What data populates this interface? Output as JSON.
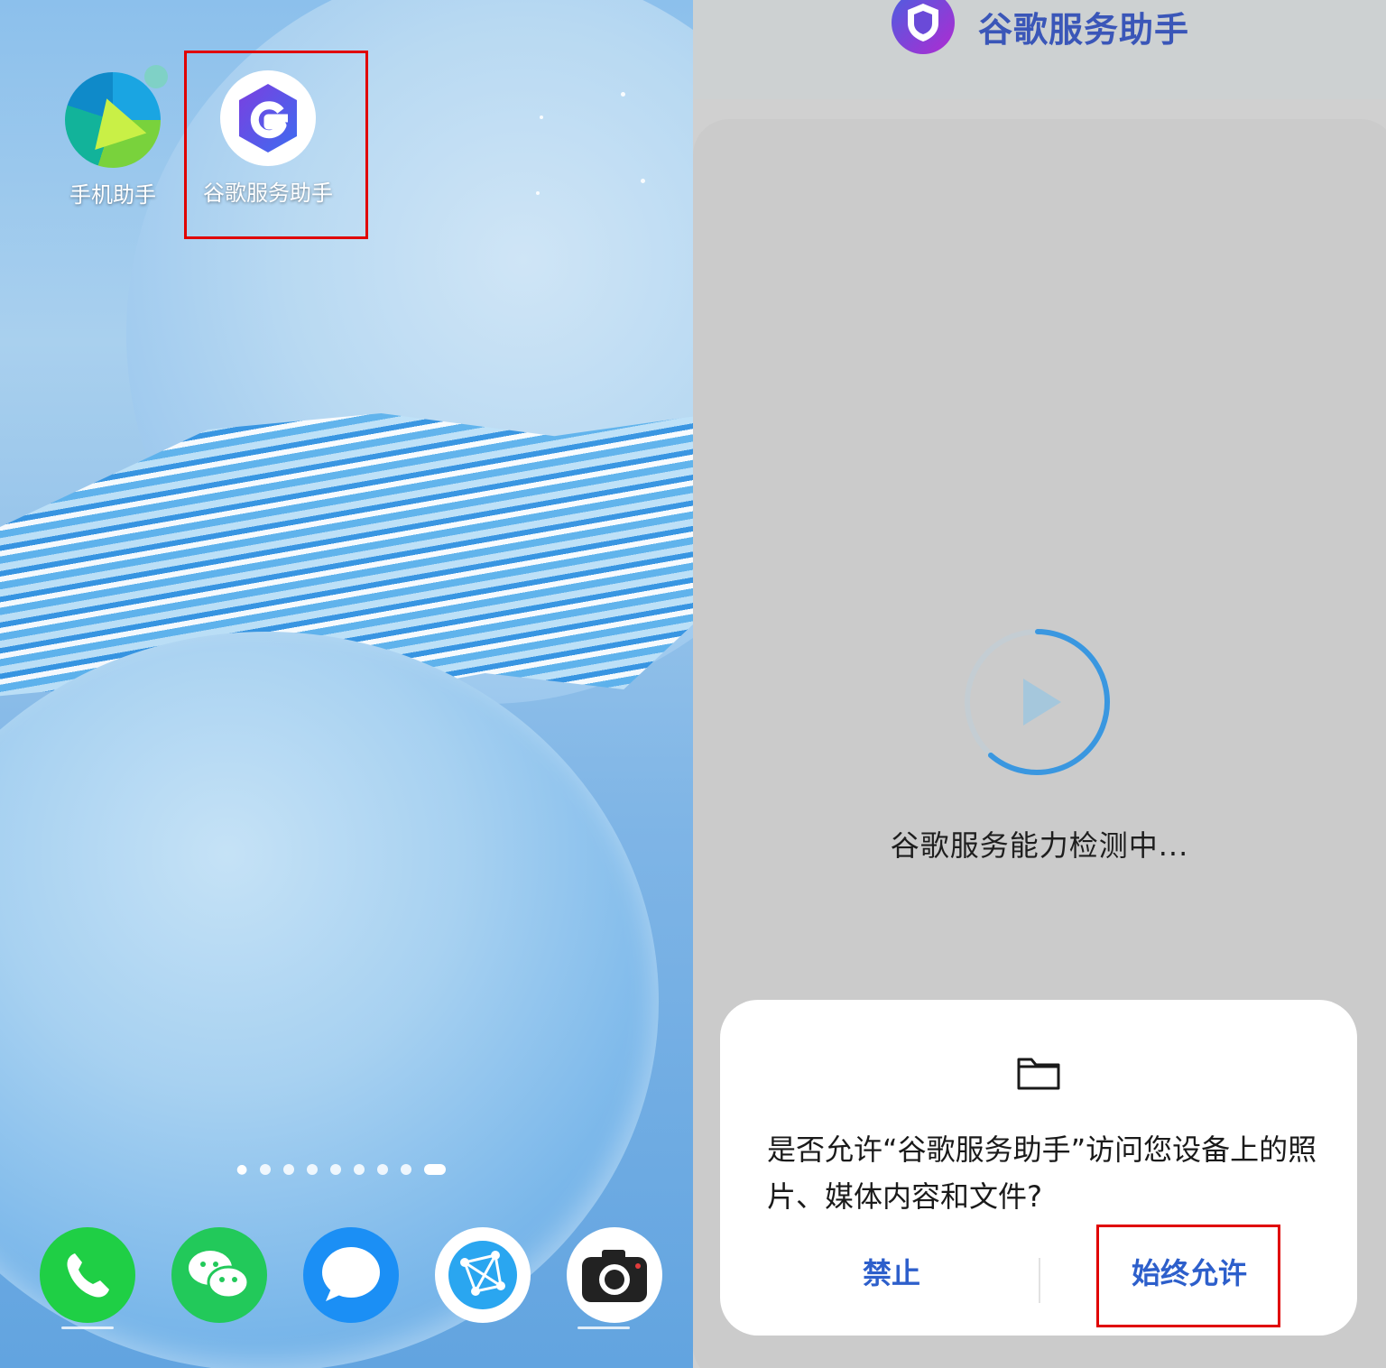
{
  "home": {
    "apps": [
      {
        "label": "手机助手"
      },
      {
        "label": "谷歌服务助手"
      }
    ],
    "page_indicator": {
      "count": 8,
      "active": 8
    },
    "dock": [
      {
        "icon": "phone-icon"
      },
      {
        "icon": "wechat-icon"
      },
      {
        "icon": "messages-icon"
      },
      {
        "icon": "browser-icon"
      },
      {
        "icon": "camera-icon"
      }
    ]
  },
  "app_screen": {
    "title": "谷歌服务助手",
    "status_text": "谷歌服务能力检测中...",
    "permission_dialog": {
      "message": "是否允许“谷歌服务助手”访问您设备上的照片、媒体内容和文件?",
      "deny_label": "禁止",
      "allow_label": "始终允许"
    }
  },
  "colors": {
    "highlight": "#e00000",
    "dialog_button": "#2d5fcb",
    "app_title": "#3a56b8"
  }
}
